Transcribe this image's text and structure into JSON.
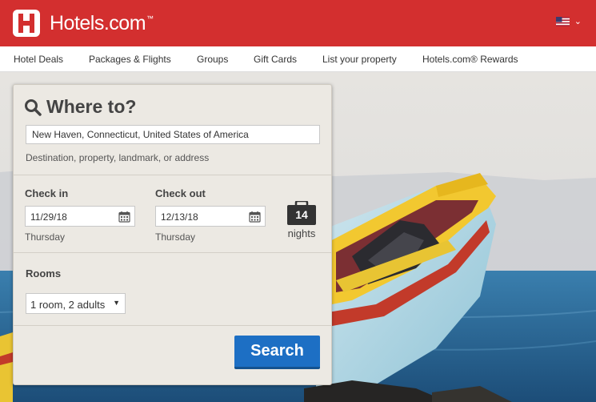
{
  "header": {
    "brand": "Hotels.com",
    "brand_tm": "™",
    "locale_icon": "us-flag-icon",
    "brand_color": "#d32f2f"
  },
  "nav": {
    "items": [
      {
        "label": "Hotel Deals"
      },
      {
        "label": "Packages & Flights"
      },
      {
        "label": "Groups"
      },
      {
        "label": "Gift Cards"
      },
      {
        "label": "List your property"
      },
      {
        "label": "Hotels.com® Rewards"
      }
    ]
  },
  "search": {
    "title": "Where to?",
    "destination_value": "New Haven, Connecticut, United States of America",
    "destination_hint": "Destination, property, landmark, or address",
    "checkin_label": "Check in",
    "checkin_value": "11/29/18",
    "checkin_day": "Thursday",
    "checkout_label": "Check out",
    "checkout_value": "12/13/18",
    "checkout_day": "Thursday",
    "nights_count": "14",
    "nights_label": "nights",
    "rooms_label": "Rooms",
    "rooms_value": "1 room, 2 adults",
    "search_button": "Search",
    "button_color": "#1d6fc4"
  }
}
